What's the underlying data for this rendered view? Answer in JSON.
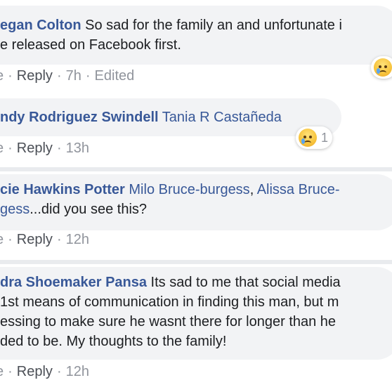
{
  "comments": [
    {
      "name": "egan Colton",
      "text_line1": " So sad for the family an and unfortunate i",
      "text_line2": "e released on Facebook first.",
      "actions": {
        "left_fragment": "e",
        "reply": "Reply",
        "time": "7h",
        "edited": "Edited"
      },
      "reaction": {
        "emoji": "sad-emoji-icon",
        "count": ""
      }
    },
    {
      "name": "ndy Rodriguez Swindell",
      "tag": " Tania R Castañeda",
      "actions": {
        "left_fragment": "e",
        "reply": "Reply",
        "time": "13h"
      },
      "reaction": {
        "emoji": "sad-emoji-icon",
        "count": "1"
      }
    },
    {
      "name": "cie Hawkins Potter",
      "tag1": " Milo Bruce-burgess",
      "comma": ", ",
      "tag2": "Alissa Bruce-",
      "line2_tag": "gess",
      "line2_text": "...did you see this?",
      "actions": {
        "left_fragment": "e",
        "reply": "Reply",
        "time": "12h"
      }
    },
    {
      "name": "dra Shoemaker Pansa",
      "text_line1": " Its sad to me that social media",
      "text_line2": " 1st means of communication in finding this man, but m",
      "text_line3": "essing to make sure he wasnt there for longer than he",
      "text_line4": "ded to be. My thoughts to the family!",
      "actions": {
        "left_fragment": "e",
        "reply": "Reply",
        "time": "12h"
      }
    }
  ],
  "sep": "·",
  "colors": {
    "link": "#385898",
    "bubble": "#f2f3f5",
    "meta": "#90949c",
    "background": "#e9ebee"
  }
}
